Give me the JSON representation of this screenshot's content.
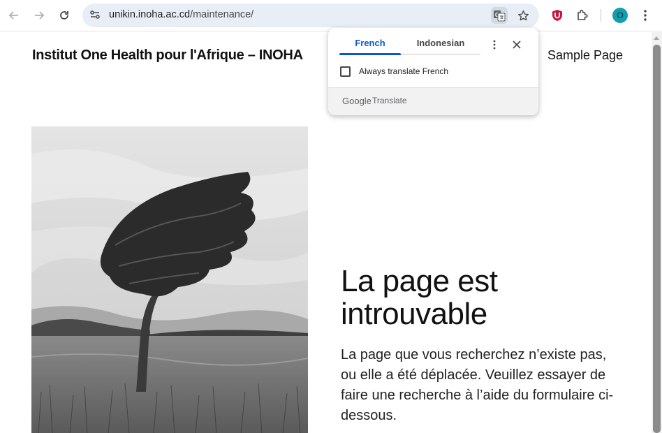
{
  "browser": {
    "url_host": "unikin.inoha.ac.cd",
    "url_path": "/maintenance/",
    "profile_initial": "O",
    "accent_color": "#0b57d0",
    "icons": [
      "back-icon",
      "forward-icon",
      "reload-icon",
      "site-info-icon",
      "translate-icon",
      "bookmark-star-icon",
      "ublock-extension-icon",
      "extensions-puzzle-icon",
      "chrome-menu-icon"
    ]
  },
  "site": {
    "title": "Institut One Health pour l'Afrique – INOHA",
    "nav": [
      "Sample Page"
    ]
  },
  "main": {
    "heading": "La page est introuvable",
    "body": "La page que vous recherchez n’existe pas, ou elle a été déplacée. Veuillez essayer de faire une recherche à l’aide du formulaire ci-dessous."
  },
  "translate_popup": {
    "tabs": [
      {
        "label": "French",
        "selected": true
      },
      {
        "label": "Indonesian",
        "selected": false
      }
    ],
    "checkbox_label": "Always translate French",
    "checkbox_checked": false,
    "footer_brand": "Google",
    "footer_product": "Translate"
  }
}
